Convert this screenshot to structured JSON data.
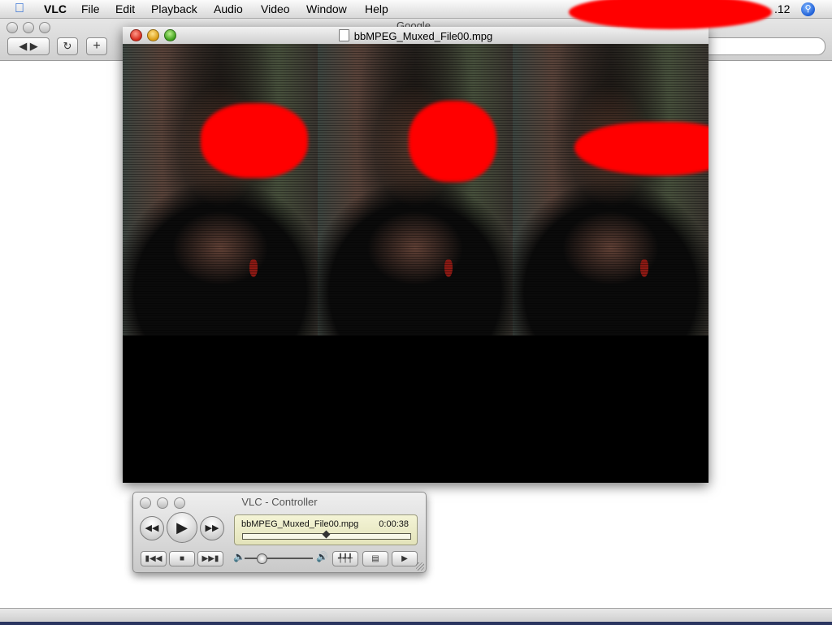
{
  "menubar": {
    "app": "VLC",
    "items": [
      "File",
      "Edit",
      "Playback",
      "Audio",
      "Video",
      "Window",
      "Help"
    ],
    "clock_partial": ".12",
    "apple_icon": "apple-logo-icon",
    "spotlight_icon": "spotlight-search-icon"
  },
  "browser": {
    "title_partial": "Google",
    "icons": {
      "back_forward": "back-forward-icon",
      "reload": "reload-icon",
      "add": "add-bookmark-icon"
    }
  },
  "video_window": {
    "title": "bbMPEG_Muxed_File00.mpg",
    "accent_red": "#ff0000"
  },
  "controller": {
    "title": "VLC - Controller",
    "file_name": "bbMPEG_Muxed_File00.mpg",
    "time": "0:00:38",
    "progress": 0.5,
    "volume": 0.25,
    "lcd_color": "#ececc8"
  }
}
